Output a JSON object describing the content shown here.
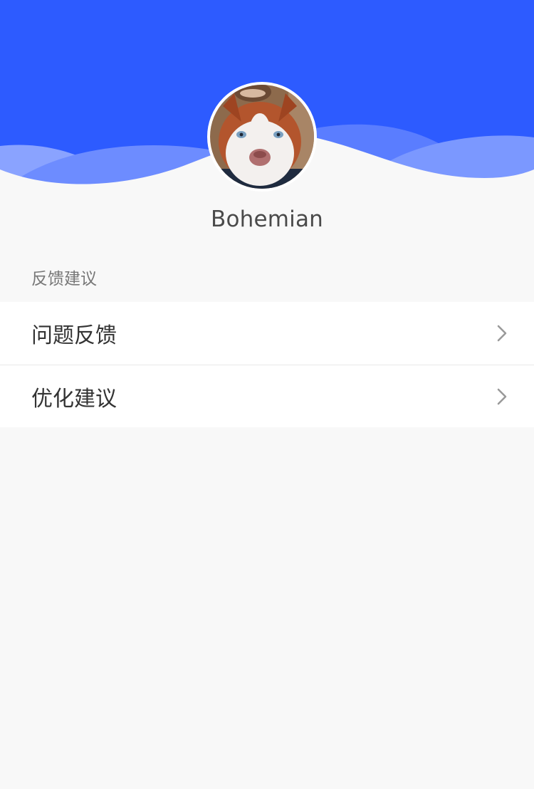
{
  "colors": {
    "header_blue": "#2d5bff",
    "wave_light": "#7f9bff",
    "page_bg": "#f8f8f8",
    "chevron": "#9a9a9a"
  },
  "profile": {
    "username": "Bohemian",
    "avatar_icon": "husky-dog-avatar"
  },
  "section": {
    "title": "反馈建议"
  },
  "menu": {
    "items": [
      {
        "label": "问题反馈",
        "icon": "chevron-right-icon"
      },
      {
        "label": "优化建议",
        "icon": "chevron-right-icon"
      }
    ]
  }
}
